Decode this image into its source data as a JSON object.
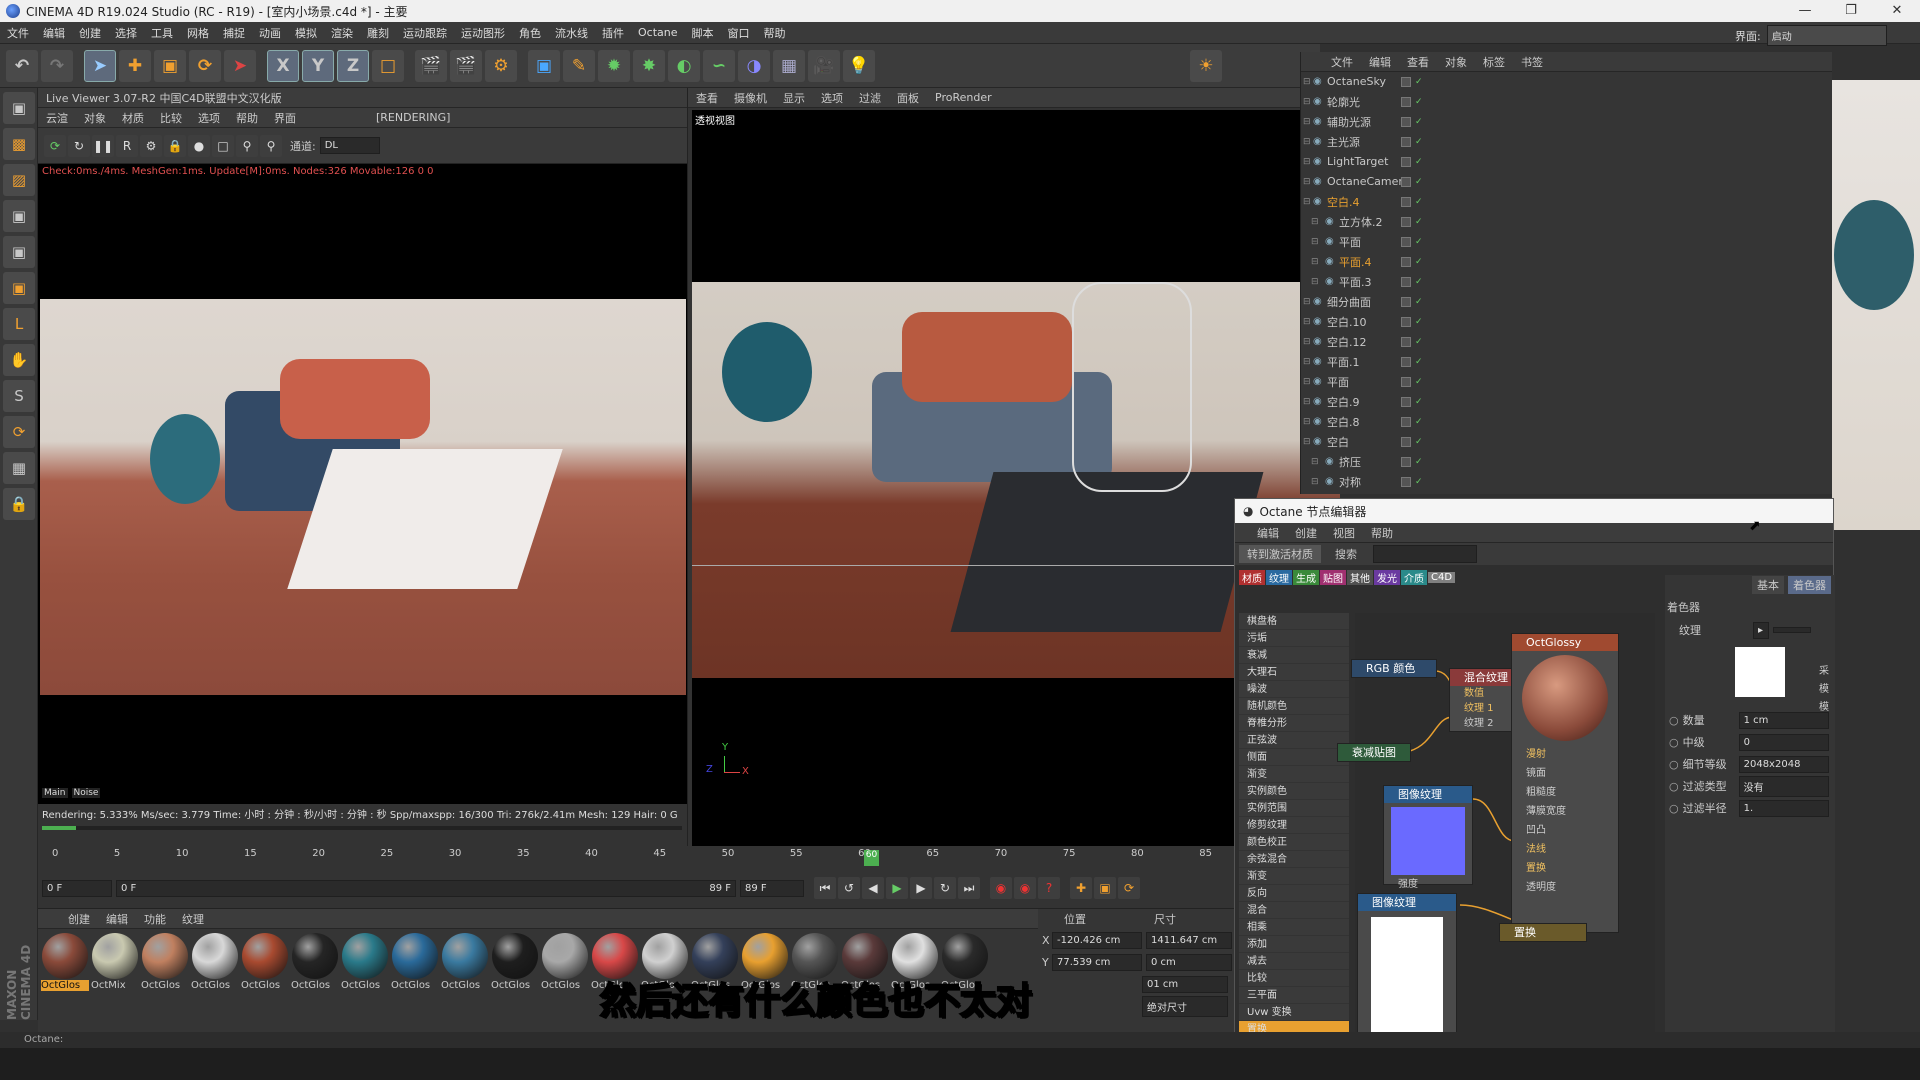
{
  "window": {
    "title": "CINEMA 4D R19.024 Studio (RC - R19) - [室内小场景.c4d *] - 主要",
    "layout_label": "界面:",
    "layout_value": "启动"
  },
  "menu": [
    "文件",
    "编辑",
    "创建",
    "选择",
    "工具",
    "网格",
    "捕捉",
    "动画",
    "模拟",
    "渲染",
    "雕刻",
    "运动跟踪",
    "运动图形",
    "角色",
    "流水线",
    "插件",
    "Octane",
    "脚本",
    "窗口",
    "帮助"
  ],
  "live_viewer": {
    "title": "Live Viewer 3.07-R2 中国C4D联盟中文汉化版",
    "menu": [
      "云渲",
      "对象",
      "材质",
      "比较",
      "选项",
      "帮助",
      "界面"
    ],
    "state": "[RENDERING]",
    "channel_label": "通道:",
    "channel_value": "DL",
    "check_line": "Check:0ms./4ms. MeshGen:1ms. Update[M]:0ms. Nodes:326 Movable:126  0 0",
    "tabs": [
      "Main",
      "Noise"
    ],
    "status": "Rendering: 5.333% Ms/sec: 3.779    Time: 小时 : 分钟 : 秒/小时 : 分钟 : 秒   Spp/maxspp: 16/300   Tri: 276k/2.41m   Mesh: 129  Hair: 0    G",
    "progress": 0.053
  },
  "viewport": {
    "menu": [
      "查看",
      "摄像机",
      "显示",
      "选项",
      "过滤",
      "面板",
      "ProRender"
    ],
    "label": "透视视图",
    "axis_y": "Y",
    "axis_x": "X",
    "axis_z": "Z",
    "corner": "网"
  },
  "objects": {
    "menu": [
      "文件",
      "编辑",
      "查看",
      "对象",
      "标签",
      "书签"
    ],
    "items": [
      {
        "name": "OctaneSky",
        "depth": 0,
        "color": "#c8c8c8"
      },
      {
        "name": "轮廓光",
        "depth": 0,
        "color": "#c8c8c8"
      },
      {
        "name": "辅助光源",
        "depth": 0,
        "color": "#c8c8c8"
      },
      {
        "name": "主光源",
        "depth": 0,
        "color": "#c8c8c8"
      },
      {
        "name": "LightTarget",
        "depth": 0,
        "color": "#c8c8c8"
      },
      {
        "name": "OctaneCamera",
        "depth": 0,
        "color": "#c8c8c8"
      },
      {
        "name": "空白.4",
        "depth": 0,
        "color": "#e8a030"
      },
      {
        "name": "立方体.2",
        "depth": 1,
        "color": "#c8c8c8"
      },
      {
        "name": "平面",
        "depth": 1,
        "color": "#c8c8c8"
      },
      {
        "name": "平面.4",
        "depth": 1,
        "color": "#e8a030"
      },
      {
        "name": "平面.3",
        "depth": 1,
        "color": "#c8c8c8"
      },
      {
        "name": "细分曲面",
        "depth": 0,
        "color": "#c8c8c8"
      },
      {
        "name": "空白.10",
        "depth": 0,
        "color": "#c8c8c8"
      },
      {
        "name": "空白.12",
        "depth": 0,
        "color": "#c8c8c8"
      },
      {
        "name": "平面.1",
        "depth": 0,
        "color": "#c8c8c8"
      },
      {
        "name": "平面",
        "depth": 0,
        "color": "#c8c8c8"
      },
      {
        "name": "空白.9",
        "depth": 0,
        "color": "#c8c8c8"
      },
      {
        "name": "空白.8",
        "depth": 0,
        "color": "#c8c8c8"
      },
      {
        "name": "空白",
        "depth": 0,
        "color": "#c8c8c8"
      },
      {
        "name": "挤压",
        "depth": 1,
        "color": "#c8c8c8"
      },
      {
        "name": "对称",
        "depth": 1,
        "color": "#c8c8c8"
      }
    ]
  },
  "node_editor": {
    "title": "Octane 节点编辑器",
    "menu": [
      "编辑",
      "创建",
      "视图",
      "帮助"
    ],
    "convert_button": "转到激活材质",
    "search_label": "搜索",
    "categories": [
      "材质",
      "纹理",
      "生成",
      "贴图",
      "其他",
      "发光",
      "介质",
      "C4D"
    ],
    "category_colors": [
      "#b03030",
      "#2a6aa0",
      "#3a8a3a",
      "#a03070",
      "#505050",
      "#6a3aa0",
      "#2a8a8a",
      "#808080"
    ],
    "node_list": [
      "棋盘格",
      "污垢",
      "衰减",
      "大理石",
      "噪波",
      "随机颜色",
      "脊椎分形",
      "正弦波",
      "侧面",
      "渐变",
      "实例颜色",
      "实例范围",
      "修剪纹理",
      "颜色校正",
      "余弦混合",
      "渐变",
      "反向",
      "混合",
      "相乘",
      "添加",
      "减去",
      "比较",
      "三平面",
      "Uvw 变换",
      "置换"
    ],
    "nodes": {
      "rgb": "RGB 颜色",
      "mix": "混合纹理",
      "mix_pins": [
        "数值",
        "纹理 1",
        "纹理 2"
      ],
      "falloff": "衰减贴图",
      "glossy": "OctGlossy",
      "glossy_pins": [
        "漫射",
        "镜面",
        "粗糙度",
        "薄膜宽度",
        "凹凸",
        "法线",
        "置换",
        "透明度"
      ],
      "image1": "图像纹理",
      "image1_pins": [
        "强度",
        "变换"
      ],
      "image2": "图像纹理",
      "displace": "置换"
    }
  },
  "attributes": {
    "tabs": [
      "基本",
      "着色器"
    ],
    "section": "着色器",
    "texture_label": "纹理",
    "right_labels": [
      "采",
      "模",
      "模"
    ],
    "rows": [
      {
        "label": "数量",
        "value": "1 cm"
      },
      {
        "label": "中级",
        "value": "0"
      },
      {
        "label": "细节等级",
        "value": "2048x2048"
      },
      {
        "label": "过滤类型",
        "value": "没有"
      },
      {
        "label": "过滤半径",
        "value": "1."
      }
    ]
  },
  "timeline": {
    "ticks": [
      "0",
      "5",
      "10",
      "15",
      "20",
      "25",
      "30",
      "35",
      "40",
      "45",
      "50",
      "55",
      "60",
      "65",
      "70",
      "75",
      "80",
      "85"
    ],
    "current_frame": 60,
    "start_field": "0 F",
    "range_start": "0 F",
    "range_end": "89 F",
    "end_field": "89 F"
  },
  "materials": {
    "menu": [
      "创建",
      "编辑",
      "功能",
      "纹理"
    ],
    "items": [
      {
        "label": "OctGlos",
        "color": "#8a4a3a",
        "selected": true
      },
      {
        "label": "OctMix",
        "color": "#c9c9b0",
        "selected": false
      },
      {
        "label": "OctGlos",
        "color": "#c08060",
        "selected": false
      },
      {
        "label": "OctGlos",
        "color": "#d8d8d8",
        "selected": false
      },
      {
        "label": "OctGlos",
        "color": "#a84a30",
        "selected": false
      },
      {
        "label": "OctGlos",
        "color": "#252525",
        "selected": false
      },
      {
        "label": "OctGlos",
        "color": "#2a7a8a",
        "selected": false
      },
      {
        "label": "OctGlos",
        "color": "#2a6a9a",
        "selected": false
      },
      {
        "label": "OctGlos",
        "color": "#3a7aa0",
        "selected": false
      },
      {
        "label": "OctGlos",
        "color": "#1e1e1e",
        "selected": false
      },
      {
        "label": "OctGlos",
        "color": "#a8a8a8",
        "selected": false
      },
      {
        "label": "OctGlos",
        "color": "#d84848",
        "selected": false
      },
      {
        "label": "OctGlos",
        "color": "#d0d0d0",
        "selected": false
      },
      {
        "label": "OctGlos",
        "color": "#34405a",
        "selected": false
      },
      {
        "label": "OctGlos",
        "color": "#e8a030",
        "selected": false
      },
      {
        "label": "OctGlos",
        "color": "#555555",
        "selected": false
      },
      {
        "label": "OctGlos",
        "color": "#5a3a3a",
        "selected": false
      },
      {
        "label": "OctGlos",
        "color": "#e0e0e0",
        "selected": false
      },
      {
        "label": "OctGlos",
        "color": "#2a2a2a",
        "selected": false
      }
    ]
  },
  "coords": {
    "pos_header": "位置",
    "size_header": "尺寸",
    "x_label": "X",
    "x_pos": "-120.426 cm",
    "x_size": "1411.647 cm",
    "y_label": "Y",
    "y_pos": "77.539 cm",
    "y_size": "0 cm",
    "z_size": "01 cm",
    "size_mode": "绝对尺寸"
  },
  "status_bar": "Octane:",
  "maxon_logo": "MAXON CINEMA 4D",
  "subtitle": "然后还有什么颜色也不太对"
}
